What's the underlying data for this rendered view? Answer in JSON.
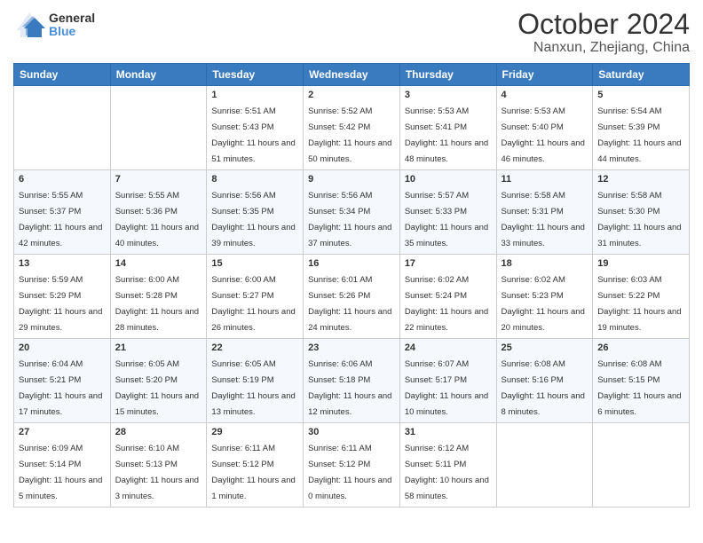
{
  "logo": {
    "line1": "General",
    "line2": "Blue"
  },
  "header": {
    "month": "October 2024",
    "location": "Nanxun, Zhejiang, China"
  },
  "days_of_week": [
    "Sunday",
    "Monday",
    "Tuesday",
    "Wednesday",
    "Thursday",
    "Friday",
    "Saturday"
  ],
  "weeks": [
    [
      {
        "day": "",
        "sunrise": "",
        "sunset": "",
        "daylight": ""
      },
      {
        "day": "",
        "sunrise": "",
        "sunset": "",
        "daylight": ""
      },
      {
        "day": "1",
        "sunrise": "Sunrise: 5:51 AM",
        "sunset": "Sunset: 5:43 PM",
        "daylight": "Daylight: 11 hours and 51 minutes."
      },
      {
        "day": "2",
        "sunrise": "Sunrise: 5:52 AM",
        "sunset": "Sunset: 5:42 PM",
        "daylight": "Daylight: 11 hours and 50 minutes."
      },
      {
        "day": "3",
        "sunrise": "Sunrise: 5:53 AM",
        "sunset": "Sunset: 5:41 PM",
        "daylight": "Daylight: 11 hours and 48 minutes."
      },
      {
        "day": "4",
        "sunrise": "Sunrise: 5:53 AM",
        "sunset": "Sunset: 5:40 PM",
        "daylight": "Daylight: 11 hours and 46 minutes."
      },
      {
        "day": "5",
        "sunrise": "Sunrise: 5:54 AM",
        "sunset": "Sunset: 5:39 PM",
        "daylight": "Daylight: 11 hours and 44 minutes."
      }
    ],
    [
      {
        "day": "6",
        "sunrise": "Sunrise: 5:55 AM",
        "sunset": "Sunset: 5:37 PM",
        "daylight": "Daylight: 11 hours and 42 minutes."
      },
      {
        "day": "7",
        "sunrise": "Sunrise: 5:55 AM",
        "sunset": "Sunset: 5:36 PM",
        "daylight": "Daylight: 11 hours and 40 minutes."
      },
      {
        "day": "8",
        "sunrise": "Sunrise: 5:56 AM",
        "sunset": "Sunset: 5:35 PM",
        "daylight": "Daylight: 11 hours and 39 minutes."
      },
      {
        "day": "9",
        "sunrise": "Sunrise: 5:56 AM",
        "sunset": "Sunset: 5:34 PM",
        "daylight": "Daylight: 11 hours and 37 minutes."
      },
      {
        "day": "10",
        "sunrise": "Sunrise: 5:57 AM",
        "sunset": "Sunset: 5:33 PM",
        "daylight": "Daylight: 11 hours and 35 minutes."
      },
      {
        "day": "11",
        "sunrise": "Sunrise: 5:58 AM",
        "sunset": "Sunset: 5:31 PM",
        "daylight": "Daylight: 11 hours and 33 minutes."
      },
      {
        "day": "12",
        "sunrise": "Sunrise: 5:58 AM",
        "sunset": "Sunset: 5:30 PM",
        "daylight": "Daylight: 11 hours and 31 minutes."
      }
    ],
    [
      {
        "day": "13",
        "sunrise": "Sunrise: 5:59 AM",
        "sunset": "Sunset: 5:29 PM",
        "daylight": "Daylight: 11 hours and 29 minutes."
      },
      {
        "day": "14",
        "sunrise": "Sunrise: 6:00 AM",
        "sunset": "Sunset: 5:28 PM",
        "daylight": "Daylight: 11 hours and 28 minutes."
      },
      {
        "day": "15",
        "sunrise": "Sunrise: 6:00 AM",
        "sunset": "Sunset: 5:27 PM",
        "daylight": "Daylight: 11 hours and 26 minutes."
      },
      {
        "day": "16",
        "sunrise": "Sunrise: 6:01 AM",
        "sunset": "Sunset: 5:26 PM",
        "daylight": "Daylight: 11 hours and 24 minutes."
      },
      {
        "day": "17",
        "sunrise": "Sunrise: 6:02 AM",
        "sunset": "Sunset: 5:24 PM",
        "daylight": "Daylight: 11 hours and 22 minutes."
      },
      {
        "day": "18",
        "sunrise": "Sunrise: 6:02 AM",
        "sunset": "Sunset: 5:23 PM",
        "daylight": "Daylight: 11 hours and 20 minutes."
      },
      {
        "day": "19",
        "sunrise": "Sunrise: 6:03 AM",
        "sunset": "Sunset: 5:22 PM",
        "daylight": "Daylight: 11 hours and 19 minutes."
      }
    ],
    [
      {
        "day": "20",
        "sunrise": "Sunrise: 6:04 AM",
        "sunset": "Sunset: 5:21 PM",
        "daylight": "Daylight: 11 hours and 17 minutes."
      },
      {
        "day": "21",
        "sunrise": "Sunrise: 6:05 AM",
        "sunset": "Sunset: 5:20 PM",
        "daylight": "Daylight: 11 hours and 15 minutes."
      },
      {
        "day": "22",
        "sunrise": "Sunrise: 6:05 AM",
        "sunset": "Sunset: 5:19 PM",
        "daylight": "Daylight: 11 hours and 13 minutes."
      },
      {
        "day": "23",
        "sunrise": "Sunrise: 6:06 AM",
        "sunset": "Sunset: 5:18 PM",
        "daylight": "Daylight: 11 hours and 12 minutes."
      },
      {
        "day": "24",
        "sunrise": "Sunrise: 6:07 AM",
        "sunset": "Sunset: 5:17 PM",
        "daylight": "Daylight: 11 hours and 10 minutes."
      },
      {
        "day": "25",
        "sunrise": "Sunrise: 6:08 AM",
        "sunset": "Sunset: 5:16 PM",
        "daylight": "Daylight: 11 hours and 8 minutes."
      },
      {
        "day": "26",
        "sunrise": "Sunrise: 6:08 AM",
        "sunset": "Sunset: 5:15 PM",
        "daylight": "Daylight: 11 hours and 6 minutes."
      }
    ],
    [
      {
        "day": "27",
        "sunrise": "Sunrise: 6:09 AM",
        "sunset": "Sunset: 5:14 PM",
        "daylight": "Daylight: 11 hours and 5 minutes."
      },
      {
        "day": "28",
        "sunrise": "Sunrise: 6:10 AM",
        "sunset": "Sunset: 5:13 PM",
        "daylight": "Daylight: 11 hours and 3 minutes."
      },
      {
        "day": "29",
        "sunrise": "Sunrise: 6:11 AM",
        "sunset": "Sunset: 5:12 PM",
        "daylight": "Daylight: 11 hours and 1 minute."
      },
      {
        "day": "30",
        "sunrise": "Sunrise: 6:11 AM",
        "sunset": "Sunset: 5:12 PM",
        "daylight": "Daylight: 11 hours and 0 minutes."
      },
      {
        "day": "31",
        "sunrise": "Sunrise: 6:12 AM",
        "sunset": "Sunset: 5:11 PM",
        "daylight": "Daylight: 10 hours and 58 minutes."
      },
      {
        "day": "",
        "sunrise": "",
        "sunset": "",
        "daylight": ""
      },
      {
        "day": "",
        "sunrise": "",
        "sunset": "",
        "daylight": ""
      }
    ]
  ]
}
